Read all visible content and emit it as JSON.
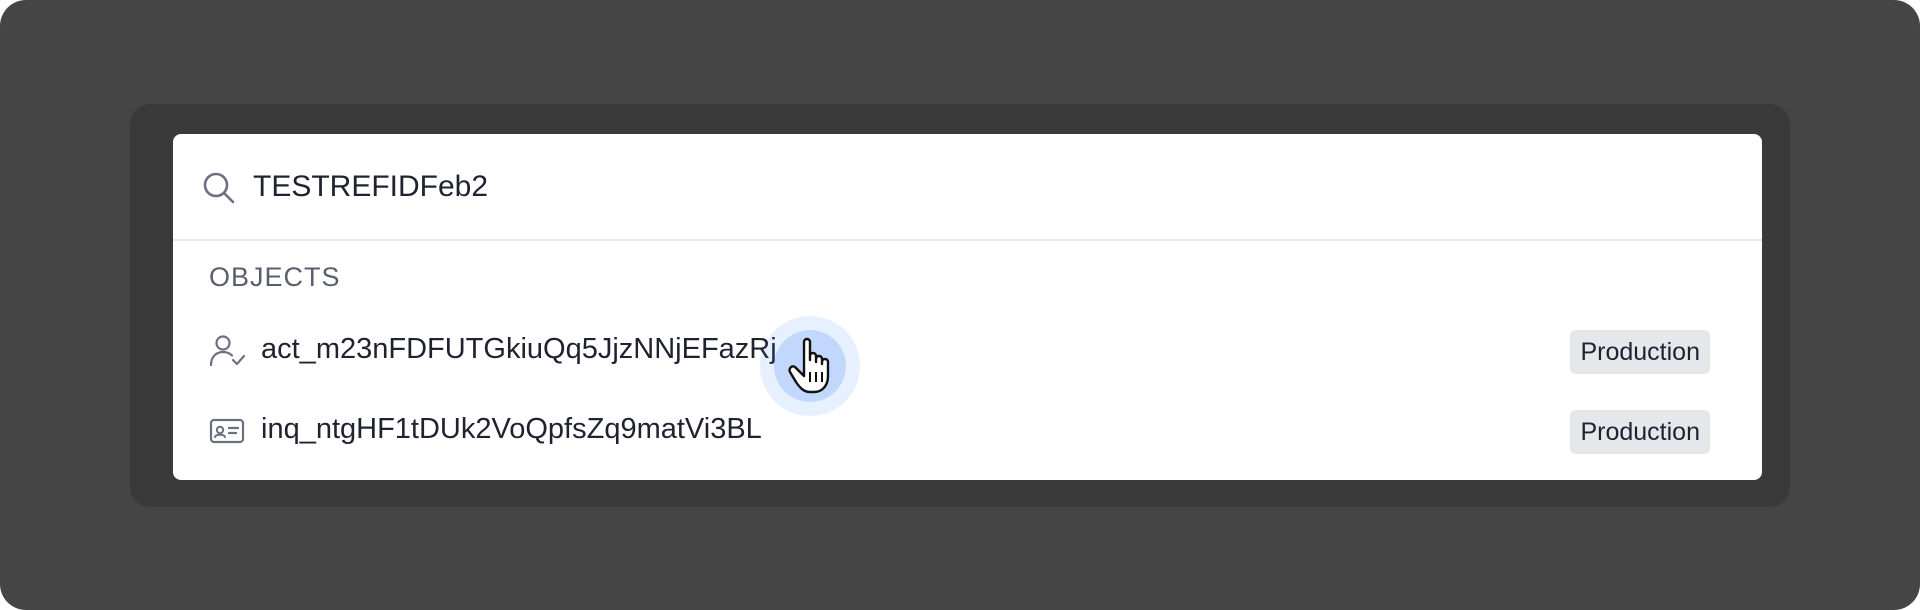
{
  "search": {
    "value": "TESTREFIDFeb2",
    "icon": "search-icon"
  },
  "section": {
    "label": "OBJECTS"
  },
  "results": [
    {
      "id": "act_m23nFDFUTGkiuQq5JjzNNjEFazRj",
      "icon": "user-check-icon",
      "environment": "Production"
    },
    {
      "id": "inq_ntgHF1tDUk2VoQpfsZq9matVi3BL",
      "icon": "id-card-icon",
      "environment": "Production"
    }
  ],
  "colors": {
    "backdrop": "#454545",
    "text": "#1f2330",
    "badge_bg": "#e6e7eb",
    "cursor_highlight": "#3b82f6"
  }
}
